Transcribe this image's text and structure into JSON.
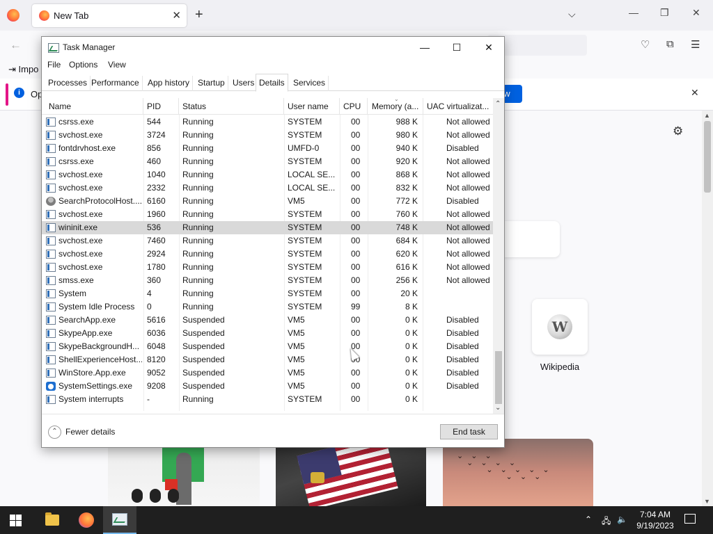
{
  "firefox": {
    "tab_title": "New Tab",
    "bookmarks_text": "Impo",
    "notice_text": "Op",
    "notice_button": "ow",
    "shortcut_label": "Wikipedia",
    "new_tab_symbol": "+",
    "close_symbol": "✕"
  },
  "task_manager": {
    "title": "Task Manager",
    "menu": [
      "File",
      "Options",
      "View"
    ],
    "tabs": [
      "Processes",
      "Performance",
      "App history",
      "Startup",
      "Users",
      "Details",
      "Services"
    ],
    "active_tab": "Details",
    "columns": [
      "Name",
      "PID",
      "Status",
      "User name",
      "CPU",
      "Memory (a...",
      "UAC virtualizat..."
    ],
    "rows": [
      {
        "name": "csrss.exe",
        "pid": "544",
        "status": "Running",
        "user": "SYSTEM",
        "cpu": "00",
        "mem": "988 K",
        "uac": "Not allowed",
        "icon": "window-icon"
      },
      {
        "name": "svchost.exe",
        "pid": "3724",
        "status": "Running",
        "user": "SYSTEM",
        "cpu": "00",
        "mem": "980 K",
        "uac": "Not allowed",
        "icon": "window-icon"
      },
      {
        "name": "fontdrvhost.exe",
        "pid": "856",
        "status": "Running",
        "user": "UMFD-0",
        "cpu": "00",
        "mem": "940 K",
        "uac": "Disabled",
        "icon": "window-icon"
      },
      {
        "name": "csrss.exe",
        "pid": "460",
        "status": "Running",
        "user": "SYSTEM",
        "cpu": "00",
        "mem": "920 K",
        "uac": "Not allowed",
        "icon": "window-icon"
      },
      {
        "name": "svchost.exe",
        "pid": "1040",
        "status": "Running",
        "user": "LOCAL SE...",
        "cpu": "00",
        "mem": "868 K",
        "uac": "Not allowed",
        "icon": "window-icon"
      },
      {
        "name": "svchost.exe",
        "pid": "2332",
        "status": "Running",
        "user": "LOCAL SE...",
        "cpu": "00",
        "mem": "832 K",
        "uac": "Not allowed",
        "icon": "window-icon"
      },
      {
        "name": "SearchProtocolHost....",
        "pid": "6160",
        "status": "Running",
        "user": "VM5",
        "cpu": "00",
        "mem": "772 K",
        "uac": "Disabled",
        "icon": "search-protocol-icon"
      },
      {
        "name": "svchost.exe",
        "pid": "1960",
        "status": "Running",
        "user": "SYSTEM",
        "cpu": "00",
        "mem": "760 K",
        "uac": "Not allowed",
        "icon": "window-icon"
      },
      {
        "name": "wininit.exe",
        "pid": "536",
        "status": "Running",
        "user": "SYSTEM",
        "cpu": "00",
        "mem": "748 K",
        "uac": "Not allowed",
        "icon": "window-icon",
        "selected": true
      },
      {
        "name": "svchost.exe",
        "pid": "7460",
        "status": "Running",
        "user": "SYSTEM",
        "cpu": "00",
        "mem": "684 K",
        "uac": "Not allowed",
        "icon": "window-icon"
      },
      {
        "name": "svchost.exe",
        "pid": "2924",
        "status": "Running",
        "user": "SYSTEM",
        "cpu": "00",
        "mem": "620 K",
        "uac": "Not allowed",
        "icon": "window-icon"
      },
      {
        "name": "svchost.exe",
        "pid": "1780",
        "status": "Running",
        "user": "SYSTEM",
        "cpu": "00",
        "mem": "616 K",
        "uac": "Not allowed",
        "icon": "window-icon"
      },
      {
        "name": "smss.exe",
        "pid": "360",
        "status": "Running",
        "user": "SYSTEM",
        "cpu": "00",
        "mem": "256 K",
        "uac": "Not allowed",
        "icon": "window-icon"
      },
      {
        "name": "System",
        "pid": "4",
        "status": "Running",
        "user": "SYSTEM",
        "cpu": "00",
        "mem": "20 K",
        "uac": "",
        "icon": "window-icon"
      },
      {
        "name": "System Idle Process",
        "pid": "0",
        "status": "Running",
        "user": "SYSTEM",
        "cpu": "99",
        "mem": "8 K",
        "uac": "",
        "icon": "window-icon"
      },
      {
        "name": "SearchApp.exe",
        "pid": "5616",
        "status": "Suspended",
        "user": "VM5",
        "cpu": "00",
        "mem": "0 K",
        "uac": "Disabled",
        "icon": "window-icon"
      },
      {
        "name": "SkypeApp.exe",
        "pid": "6036",
        "status": "Suspended",
        "user": "VM5",
        "cpu": "00",
        "mem": "0 K",
        "uac": "Disabled",
        "icon": "window-icon"
      },
      {
        "name": "SkypeBackgroundH...",
        "pid": "6048",
        "status": "Suspended",
        "user": "VM5",
        "cpu": "00",
        "mem": "0 K",
        "uac": "Disabled",
        "icon": "window-icon"
      },
      {
        "name": "ShellExperienceHost...",
        "pid": "8120",
        "status": "Suspended",
        "user": "VM5",
        "cpu": "00",
        "mem": "0 K",
        "uac": "Disabled",
        "icon": "window-icon"
      },
      {
        "name": "WinStore.App.exe",
        "pid": "9052",
        "status": "Suspended",
        "user": "VM5",
        "cpu": "00",
        "mem": "0 K",
        "uac": "Disabled",
        "icon": "window-icon"
      },
      {
        "name": "SystemSettings.exe",
        "pid": "9208",
        "status": "Suspended",
        "user": "VM5",
        "cpu": "00",
        "mem": "0 K",
        "uac": "Disabled",
        "icon": "settings-gear-icon"
      },
      {
        "name": "System interrupts",
        "pid": "-",
        "status": "Running",
        "user": "SYSTEM",
        "cpu": "00",
        "mem": "0 K",
        "uac": "",
        "icon": "window-icon"
      }
    ],
    "fewer_details": "Fewer details",
    "end_task": "End task"
  },
  "taskbar": {
    "time": "7:04 AM",
    "date": "9/19/2023",
    "pinned": [
      "file-explorer",
      "firefox",
      "task-manager"
    ],
    "active": "task-manager"
  }
}
